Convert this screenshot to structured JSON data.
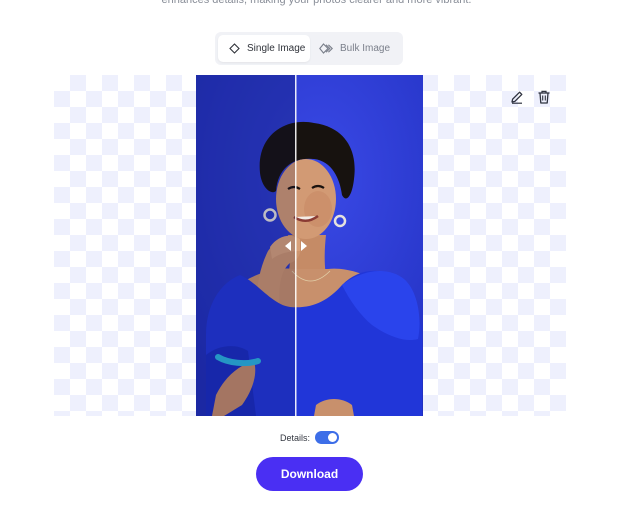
{
  "intro": {
    "text": "enhances details, making your photos clearer and more vibrant."
  },
  "mode_toggle": {
    "tabs": [
      {
        "label": "Single Image",
        "icon": "diamond-icon",
        "active": true
      },
      {
        "label": "Bulk Image",
        "icon": "layers-icon",
        "active": false
      }
    ]
  },
  "workspace": {
    "image_alt": "Woman in blue top posing against a blue background, before/after comparison",
    "tools": [
      {
        "icon": "pencil-icon"
      },
      {
        "icon": "trash-icon"
      }
    ]
  },
  "details": {
    "label": "Details:",
    "enabled": true
  },
  "download": {
    "label": "Download"
  },
  "colors": {
    "accent": "#4a2ff3",
    "toggle_on": "#3d6ee8",
    "background_blue": "#2a38cf",
    "checker": "#eef0fd"
  }
}
